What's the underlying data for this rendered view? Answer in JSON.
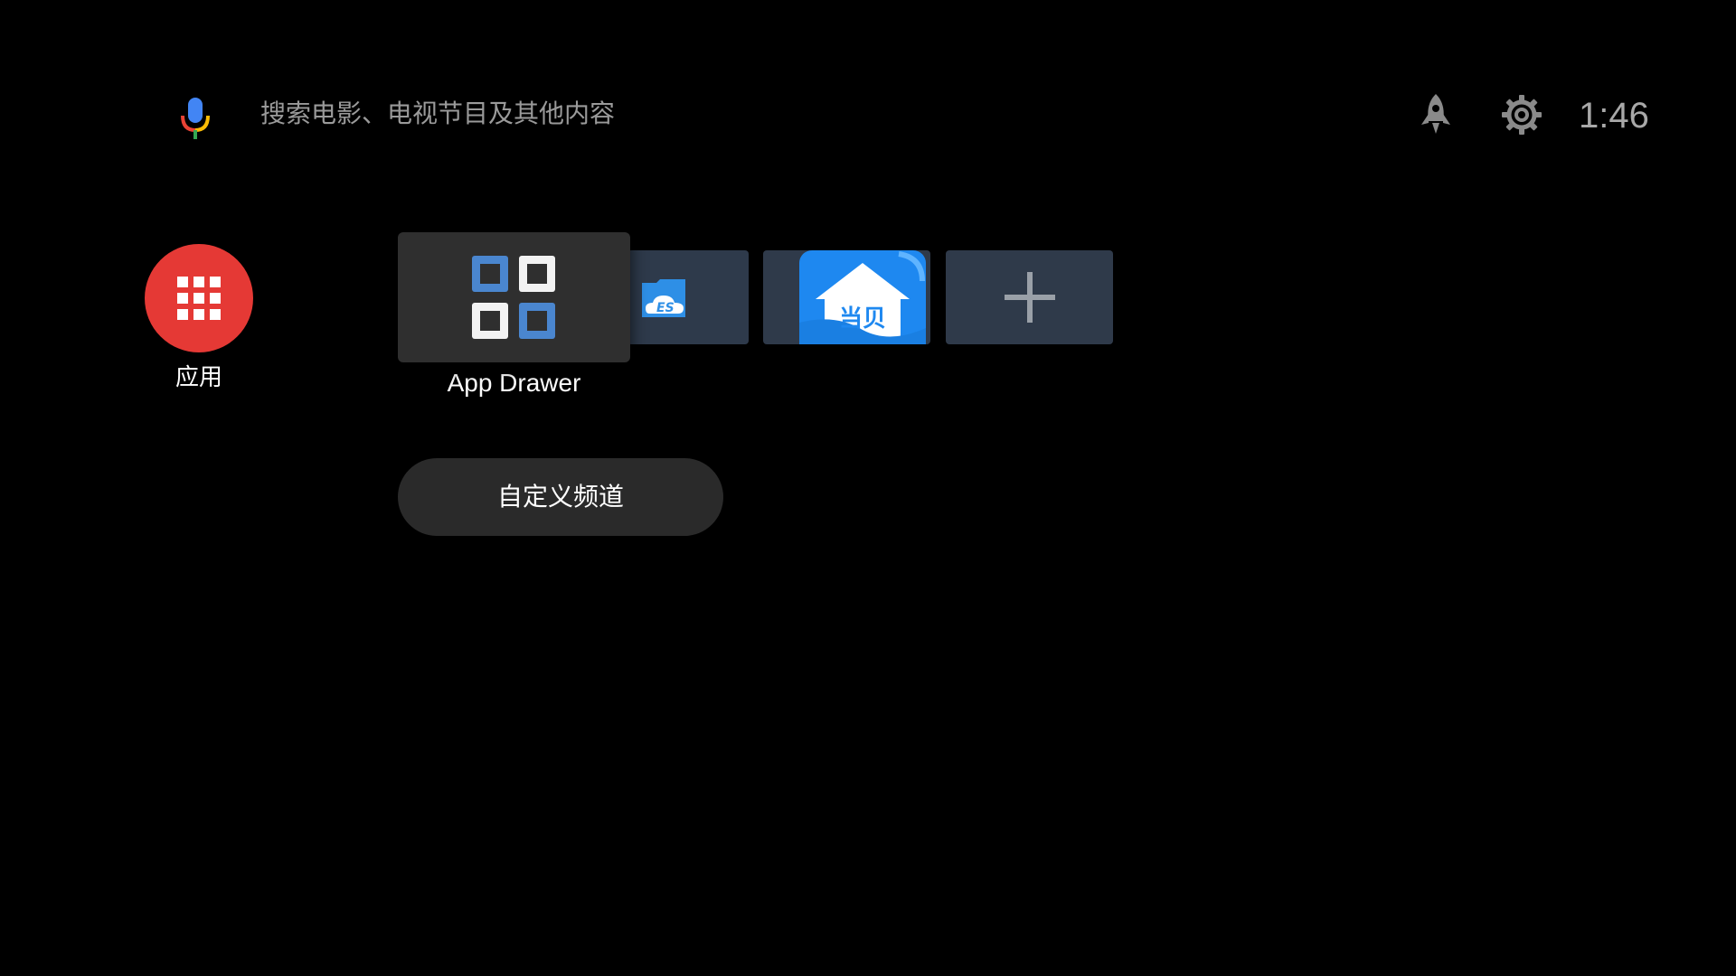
{
  "search": {
    "placeholder": "搜索电影、电视节目及其他内容"
  },
  "status": {
    "time": "1:46"
  },
  "apps_button": {
    "label": "应用"
  },
  "app_row": {
    "focused_label": "App Drawer",
    "tiles": [
      {
        "name": "App Drawer",
        "icon": "app-drawer-icon"
      },
      {
        "name": "ES File Explorer",
        "icon": "es-file-icon"
      },
      {
        "name": "当贝",
        "icon": "dangbei-house-icon"
      },
      {
        "name": "add",
        "icon": "plus-icon"
      }
    ]
  },
  "dangbei_logo_text": "当贝",
  "customize": {
    "label": "自定义频道"
  },
  "colors": {
    "background": "#000000",
    "apps_button": "#e53935",
    "tile": "#2f3a4a",
    "focused_tile": "#2f2f2f",
    "pill": "#2a2a2a",
    "drawer_blue": "#4a86cf"
  },
  "icons": [
    "mic-icon",
    "rocket-icon",
    "gear-icon",
    "grid-icon",
    "app-drawer-icon",
    "es-file-icon",
    "dangbei-house-icon",
    "plus-icon"
  ]
}
